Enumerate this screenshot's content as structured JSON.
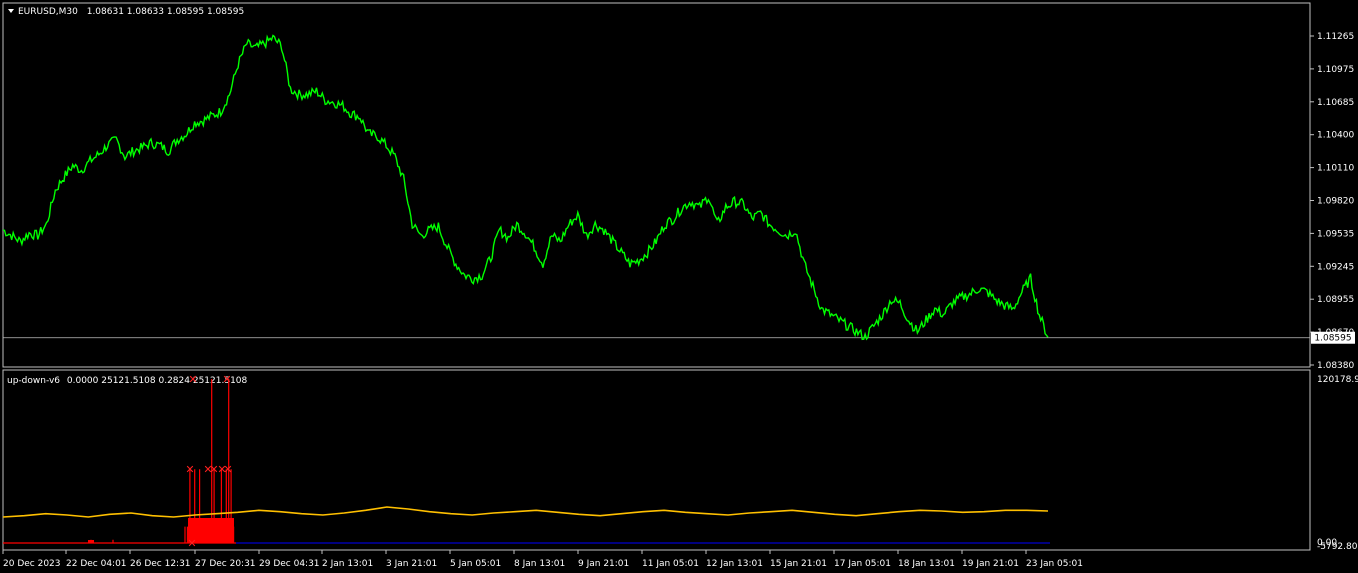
{
  "chart_data": [
    {
      "type": "line",
      "header": {
        "symbol": "EURUSD,M30",
        "ohlc": "1.08631 1.08633 1.08595 1.08595"
      },
      "yticks": [
        "1.11265",
        "1.10975",
        "1.10685",
        "1.10400",
        "1.10110",
        "1.09820",
        "1.09535",
        "1.09245",
        "1.08955",
        "1.08670",
        "1.08380"
      ],
      "ylim": [
        1.0838,
        1.1141
      ],
      "current_price": "1.08595",
      "series": [
        {
          "color": "#00ff00",
          "values": [
            1.0955,
            1.095,
            1.0945,
            1.0952,
            1.095,
            1.096,
            1.099,
            1.1002,
            1.1012,
            1.1008,
            1.1016,
            1.1022,
            1.103,
            1.1035,
            1.102,
            1.1025,
            1.1028,
            1.1032,
            1.103,
            1.1025,
            1.1035,
            1.104,
            1.105,
            1.1052,
            1.1056,
            1.106,
            1.1075,
            1.1102,
            1.112,
            1.1116,
            1.112,
            1.1125,
            1.1118,
            1.108,
            1.1075,
            1.1075,
            1.1078,
            1.107,
            1.1068,
            1.1065,
            1.1058,
            1.1055,
            1.104,
            1.1038,
            1.103,
            1.102,
            1.1,
            1.096,
            1.095,
            1.0955,
            1.0958,
            1.094,
            1.0925,
            1.0915,
            1.0912,
            1.0915,
            1.093,
            1.0955,
            1.0948,
            1.096,
            1.0952,
            1.094,
            1.0925,
            1.095,
            1.0945,
            1.096,
            1.0968,
            1.095,
            1.096,
            1.0955,
            1.0945,
            1.0935,
            1.0925,
            1.0928,
            1.0935,
            1.0945,
            1.096,
            1.0965,
            1.0975,
            1.098,
            1.0975,
            1.0985,
            1.096,
            1.0975,
            1.098,
            1.0978,
            1.0965,
            1.097,
            1.096,
            1.0955,
            1.095,
            1.0955,
            1.0925,
            1.0905,
            1.0885,
            1.088,
            1.0875,
            1.087,
            1.0865,
            1.086,
            1.087,
            1.088,
            1.0893,
            1.089,
            1.0875,
            1.0865,
            1.0875,
            1.0885,
            1.088,
            1.089,
            1.0895,
            1.0898,
            1.0903,
            1.09,
            1.0893,
            1.0888,
            1.0885,
            1.09,
            1.0912,
            1.088,
            1.086
          ]
        }
      ]
    },
    {
      "type": "line",
      "header": {
        "name": "up-down-v6",
        "values": "0.0000 25121.5108 0.2824 25121.5108"
      },
      "yticks": [
        "120178.93",
        "0.00",
        "-5792.806"
      ],
      "series": [
        {
          "color": "#ffc000",
          "values": [
            0.9,
            0.92,
            0.95,
            0.93,
            0.9,
            0.94,
            0.96,
            0.92,
            0.9,
            0.93,
            0.95,
            0.97,
            1.0,
            0.98,
            0.95,
            0.93,
            0.96,
            1.0,
            1.05,
            1.02,
            0.98,
            0.95,
            0.93,
            0.96,
            0.98,
            1.0,
            0.97,
            0.94,
            0.92,
            0.95,
            0.98,
            1.0,
            0.97,
            0.95,
            0.93,
            0.96,
            0.98,
            1.0,
            0.97,
            0.94,
            0.92,
            0.95,
            0.98,
            1.0,
            0.99,
            0.97,
            0.98,
            1.0,
            1.0,
            0.99
          ]
        },
        {
          "color": "#ff0000",
          "values": [
            0,
            0,
            0,
            0,
            0.02,
            0.02,
            0,
            0,
            0,
            0.1,
            0.1,
            0.45,
            0.1,
            0.45,
            0.1,
            0.45,
            0.1,
            0.1,
            0.12,
            0.1,
            1.0,
            0.45,
            0.1,
            0,
            0.45,
            0.1,
            0.45,
            1.0,
            0.45,
            0.1,
            0
          ]
        }
      ],
      "markers": [
        0.0,
        1.0,
        0.45,
        0.45,
        0.45,
        0.45,
        1.0,
        0.45
      ]
    }
  ],
  "xticks": [
    "20 Dec 2023",
    "22 Dec 04:01",
    "26 Dec 12:31",
    "27 Dec 20:31",
    "29 Dec 04:31",
    "2 Jan 13:01",
    "3 Jan 21:01",
    "5 Jan 05:01",
    "8 Jan 13:01",
    "9 Jan 21:01",
    "11 Jan 05:01",
    "12 Jan 13:01",
    "15 Jan 21:01",
    "17 Jan 05:01",
    "18 Jan 13:01",
    "19 Jan 21:01",
    "23 Jan 05:01"
  ]
}
